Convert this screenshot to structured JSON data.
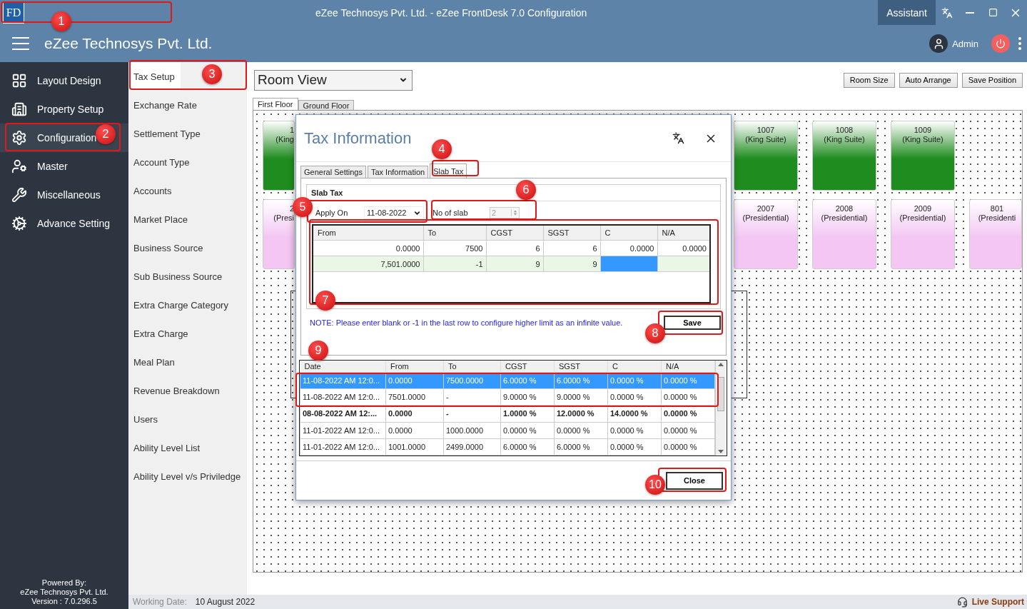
{
  "window": {
    "logo": "FD",
    "title": "eZee Technosys Pvt. Ltd. - eZee FrontDesk 7.0 Configuration",
    "assistant": "Assistant"
  },
  "app_bar": {
    "company": "eZee Technosys Pvt. Ltd.",
    "user": "Admin"
  },
  "sidebar": {
    "items": [
      {
        "label": "Layout Design",
        "selected": false
      },
      {
        "label": "Property Setup",
        "selected": false
      },
      {
        "label": "Configuration",
        "selected": true
      },
      {
        "label": "Master",
        "selected": false
      },
      {
        "label": "Miscellaneous",
        "selected": false
      },
      {
        "label": "Advance Setting",
        "selected": false
      }
    ],
    "footer": [
      "Powered By:",
      "eZee Technosys Pvt. Ltd.",
      "Version : 7.0.296.5"
    ]
  },
  "submenu": [
    {
      "label": "Tax Setup",
      "selected": true
    },
    {
      "label": "Exchange Rate",
      "selected": false
    },
    {
      "label": "Settlement Type",
      "selected": false
    },
    {
      "label": "Account Type",
      "selected": false
    },
    {
      "label": "Accounts",
      "selected": false
    },
    {
      "label": "Market Place",
      "selected": false
    },
    {
      "label": "Business Source",
      "selected": false
    },
    {
      "label": "Sub Business Source",
      "selected": false
    },
    {
      "label": "Extra Charge Category",
      "selected": false
    },
    {
      "label": "Extra Charge",
      "selected": false
    },
    {
      "label": "Meal Plan",
      "selected": false
    },
    {
      "label": "Revenue Breakdown",
      "selected": false
    },
    {
      "label": "Users",
      "selected": false
    },
    {
      "label": "Ability Level List",
      "selected": false
    },
    {
      "label": "Ability Level v/s Priviledge",
      "selected": false
    }
  ],
  "toolbar": {
    "view": "Room View",
    "buttons": [
      "Room Size",
      "Auto Arrange",
      "Save Position"
    ]
  },
  "floor_tabs": [
    {
      "label": "First Floor",
      "selected": true
    },
    {
      "label": "Ground Floor",
      "selected": false
    }
  ],
  "room_rows": [
    {
      "cards": [
        {
          "number": "1",
          "type": "(King",
          "kind": "cut",
          "color": "#1e8c1e"
        },
        {
          "number": "1007",
          "type": "(King Suite)",
          "kind": "full",
          "color": "#1e8c1e"
        },
        {
          "number": "1008",
          "type": "(King Suite)",
          "kind": "full",
          "color": "#1e8c1e"
        },
        {
          "number": "1009",
          "type": "(King Suite)",
          "kind": "full",
          "color": "#1e8c1e"
        }
      ]
    },
    {
      "cards": [
        {
          "number": "2",
          "type": "(Presi",
          "kind": "cut",
          "color": "#f3c6f3"
        },
        {
          "number": "2007",
          "type": "(Presidential)",
          "kind": "full",
          "color": "#f3c6f3"
        },
        {
          "number": "2008",
          "type": "(Presidential)",
          "kind": "full",
          "color": "#f3c6f3"
        },
        {
          "number": "2009",
          "type": "(Presidential)",
          "kind": "full",
          "color": "#f3c6f3"
        },
        {
          "number": "801",
          "type": "(Presidenti",
          "kind": "edge",
          "color": "#f3c6f3"
        }
      ]
    }
  ],
  "status_bar": {
    "label": "Working Date:",
    "date": "10 August 2022",
    "support": "Live Support"
  },
  "dialog": {
    "title": "Tax Information",
    "tabs": [
      {
        "label": "General Settings",
        "selected": false
      },
      {
        "label": "Tax Information",
        "selected": false
      },
      {
        "label": "Slab Tax",
        "selected": true
      }
    ],
    "group_title": "Slab Tax",
    "apply_on_label": "Apply On",
    "apply_on": "11-08-2022",
    "slab_label": "No of slab",
    "slab_count": "2",
    "slab_grid": {
      "columns": [
        "From",
        "To",
        "CGST",
        "SGST",
        "C",
        "N/A"
      ],
      "rows": [
        {
          "editing": false,
          "cells": [
            {
              "text": "0.0000",
              "focused": false
            },
            {
              "text": "7500",
              "focused": false
            },
            {
              "text": "6",
              "focused": false
            },
            {
              "text": "6",
              "focused": false
            },
            {
              "text": "0.0000",
              "focused": false
            },
            {
              "text": "0.0000",
              "focused": false
            }
          ]
        },
        {
          "editing": true,
          "cells": [
            {
              "text": "7,501.0000",
              "focused": false
            },
            {
              "text": "-1",
              "focused": false
            },
            {
              "text": "9",
              "focused": false
            },
            {
              "text": "9",
              "focused": false
            },
            {
              "focused": true
            },
            {
              "focused": false
            }
          ]
        }
      ]
    },
    "note": "NOTE: Please enter blank or -1 in the last row to configure higher limit as an infinite value.",
    "save": "Save",
    "history": {
      "columns": [
        "Date",
        "From",
        "To",
        "CGST",
        "SGST",
        "C",
        "N/A"
      ],
      "rows": [
        {
          "selected": true,
          "bold": false,
          "cells": [
            "11-08-2022 AM 12:0...",
            "0.0000",
            "7500.0000",
            "6.0000 %",
            "6.0000 %",
            "0.0000 %",
            "0.0000 %"
          ]
        },
        {
          "selected": false,
          "bold": false,
          "cells": [
            "11-08-2022 AM 12:0...",
            "7501.0000",
            "-",
            "9.0000 %",
            "9.0000 %",
            "0.0000 %",
            "0.0000 %"
          ]
        },
        {
          "selected": false,
          "bold": true,
          "cells": [
            "08-08-2022 AM 12:...",
            "0.0000",
            "-",
            "1.0000 %",
            "12.0000 %",
            "14.0000 %",
            "0.0000 %"
          ]
        },
        {
          "selected": false,
          "bold": false,
          "cells": [
            "11-01-2022 AM 12:0...",
            "0.0000",
            "1000.0000",
            "0.0000 %",
            "0.0000 %",
            "0.0000 %",
            "0.0000 %"
          ]
        },
        {
          "selected": false,
          "bold": false,
          "cells": [
            "11-01-2022 AM 12:0...",
            "1001.0000",
            "2499.0000",
            "6.0000 %",
            "6.0000 %",
            "0.0000 %",
            "0.0000 %"
          ]
        }
      ]
    },
    "close": "Close"
  },
  "annotations": [
    {
      "number": "1"
    },
    {
      "number": "2"
    },
    {
      "number": "3"
    },
    {
      "number": "4"
    },
    {
      "number": "5"
    },
    {
      "number": "6"
    },
    {
      "number": "7"
    },
    {
      "number": "8"
    },
    {
      "number": "9"
    },
    {
      "number": "10"
    }
  ]
}
